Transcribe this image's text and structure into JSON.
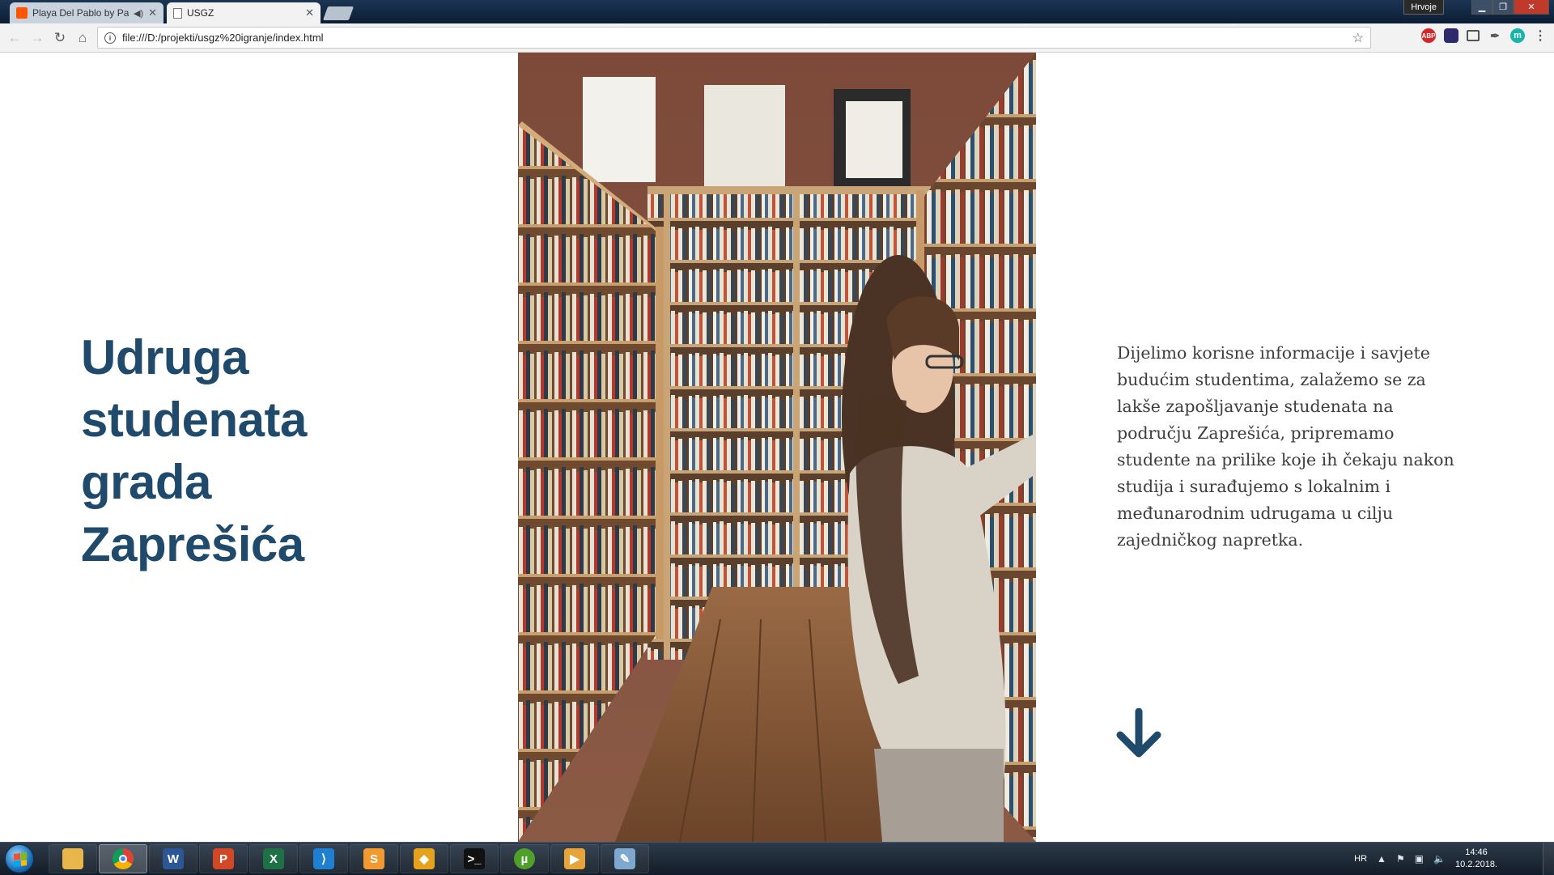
{
  "browser": {
    "tabs": [
      {
        "title": "Playa Del Pablo by Pa",
        "icon": "soundcloud-icon",
        "playing_audio": true
      },
      {
        "title": "USGZ",
        "icon": "document-icon"
      }
    ],
    "user_badge": "Hrvoje",
    "address_bar": {
      "url": "file:///D:/projekti/usgz%20igranje/index.html"
    },
    "extensions": [
      {
        "name": "adblock-plus-icon",
        "label": "ABP",
        "color": "#d7262a"
      },
      {
        "name": "extension-icon",
        "label": "",
        "color": "#2d2a6e"
      },
      {
        "name": "screenshot-icon",
        "label": "",
        "color": "#555555"
      },
      {
        "name": "eyedropper-icon",
        "label": "",
        "color": "#555555"
      },
      {
        "name": "m-extension-icon",
        "label": "m",
        "color": "#16b4a9"
      }
    ]
  },
  "page": {
    "heading_lines": [
      "Udruga",
      "studenata",
      "grada",
      "Zaprešića"
    ],
    "description_lines": [
      "Dijelimo korisne informacije i savjete",
      "budućim studentima, zalažemo se za",
      "lakše zapošljavanje studenata na",
      "području Zaprešića, pripremamo",
      "studente na prilike koje ih čekaju nakon",
      "studija i surađujemo s lokalnim i",
      "međunarodnim udrugama u cilju",
      "zajedničkog napretka."
    ],
    "colors": {
      "heading": "#1f4a6b",
      "arrow": "#1f4a6b",
      "text": "#3d3d3d"
    }
  },
  "taskbar": {
    "apps": [
      {
        "name": "file-explorer-icon",
        "color": "#e8b64a",
        "glyph": ""
      },
      {
        "name": "chrome-icon",
        "color": "#db4437",
        "glyph": "",
        "active": true
      },
      {
        "name": "word-icon",
        "color": "#2b5797",
        "glyph": "W"
      },
      {
        "name": "powerpoint-icon",
        "color": "#d24726",
        "glyph": "P"
      },
      {
        "name": "excel-icon",
        "color": "#1e7145",
        "glyph": "X"
      },
      {
        "name": "vscode-icon",
        "color": "#1f7fd0",
        "glyph": "⟩"
      },
      {
        "name": "sublime-text-icon",
        "color": "#f29a2f",
        "glyph": "S"
      },
      {
        "name": "git-icon",
        "color": "#e6a21a",
        "glyph": "◆"
      },
      {
        "name": "terminal-icon",
        "color": "#111111",
        "glyph": ">_"
      },
      {
        "name": "utorrent-icon",
        "color": "#4fa02a",
        "glyph": "µ"
      },
      {
        "name": "media-player-icon",
        "color": "#e7a43b",
        "glyph": "▶"
      },
      {
        "name": "paint-icon",
        "color": "#7fa8d1",
        "glyph": "✎"
      }
    ],
    "language": "HR",
    "time": "14:46",
    "date": "10.2.2018."
  }
}
